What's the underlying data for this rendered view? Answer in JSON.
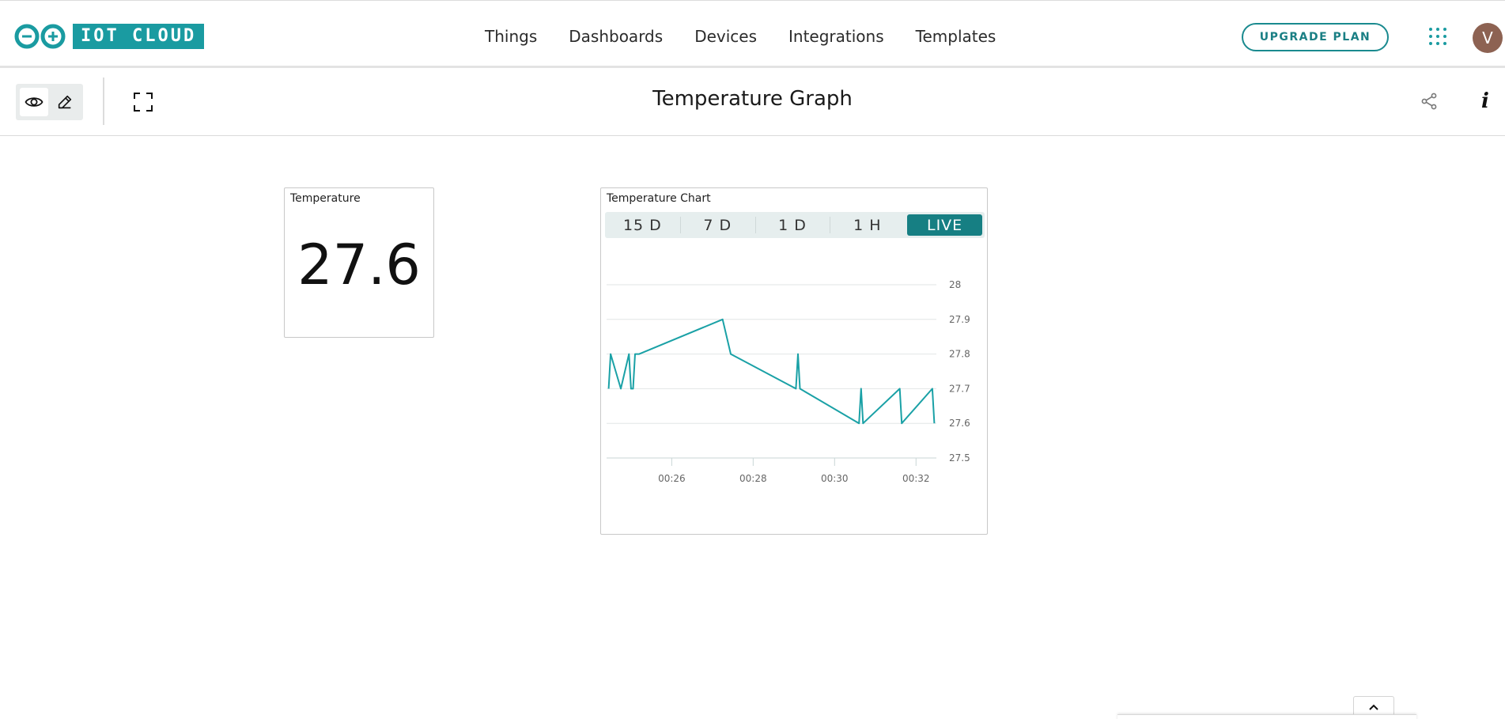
{
  "header": {
    "logo_text": "IOT CLOUD",
    "nav": [
      "Things",
      "Dashboards",
      "Devices",
      "Integrations",
      "Templates"
    ],
    "upgrade_label": "UPGRADE PLAN",
    "avatar_initial": "V"
  },
  "toolbar": {
    "title": "Temperature Graph",
    "info_glyph": "i"
  },
  "widgets": {
    "value": {
      "title": "Temperature",
      "value": "27.6"
    },
    "chart": {
      "title": "Temperature Chart",
      "tabs": [
        "15 D",
        "7 D",
        "1 D",
        "1 H",
        "LIVE"
      ],
      "active_tab": "LIVE"
    }
  },
  "colors": {
    "brand": "#1a9ba1",
    "accent": "#167f83",
    "line": "#1aa1a6",
    "avatar": "#8d6252"
  },
  "chart_data": {
    "type": "line",
    "title": "Temperature Chart",
    "xlabel": "",
    "ylabel": "",
    "y_ticks": [
      "28",
      "27.9",
      "27.8",
      "27.7",
      "27.6",
      "27.5"
    ],
    "x_ticks": [
      "00:26",
      "00:28",
      "00:30",
      "00:32"
    ],
    "x_tick_minutes": [
      26,
      28,
      30,
      32
    ],
    "ylim": [
      27.5,
      28
    ],
    "xlim_minutes": [
      24.4,
      32.5
    ],
    "grid": true,
    "series": [
      {
        "x_minutes": [
          24.45,
          24.5,
          24.75,
          24.95,
          25.0,
          25.05,
          25.1,
          25.2,
          27.25,
          27.45,
          29.05,
          29.1,
          29.15,
          30.6,
          30.65,
          30.7,
          31.6,
          31.65,
          32.4,
          32.45
        ],
        "values": [
          27.7,
          27.8,
          27.7,
          27.8,
          27.7,
          27.7,
          27.8,
          27.8,
          27.9,
          27.8,
          27.7,
          27.8,
          27.7,
          27.6,
          27.7,
          27.6,
          27.7,
          27.6,
          27.7,
          27.6
        ]
      }
    ]
  }
}
